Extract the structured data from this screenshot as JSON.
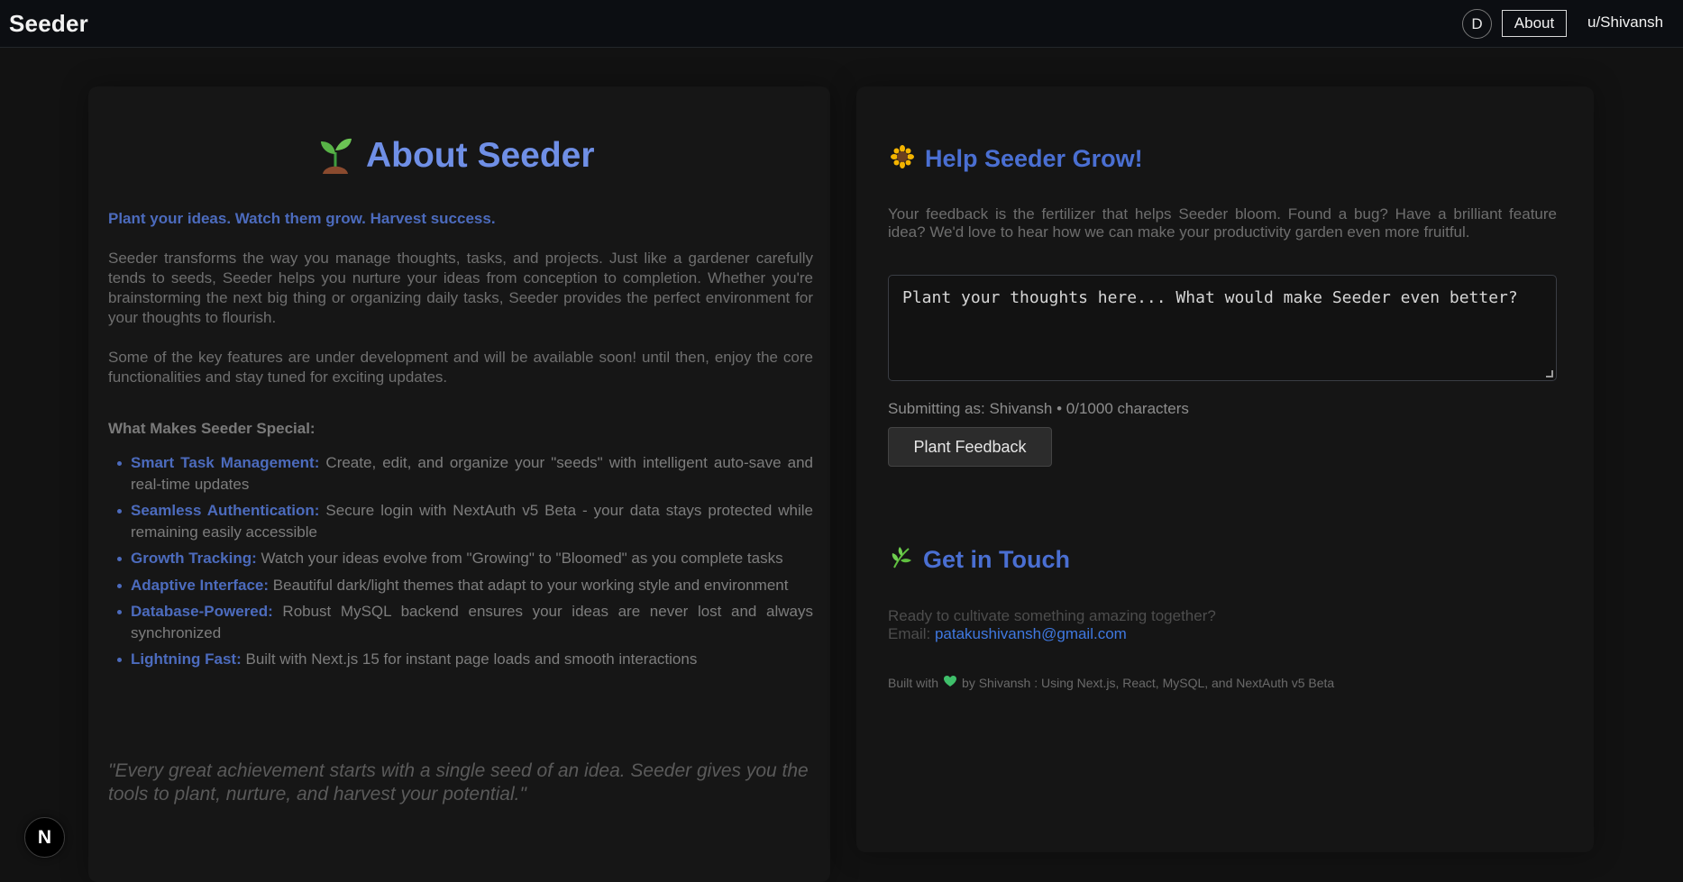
{
  "header": {
    "brand": "Seeder",
    "avatar_initial": "D",
    "about_label": "About",
    "user_label": "u/Shivansh"
  },
  "about": {
    "title": "About Seeder",
    "title_icon": "seedling-icon",
    "tagline": "Plant your ideas. Watch them grow. Harvest success.",
    "paragraph1": "Seeder transforms the way you manage thoughts, tasks, and projects. Just like a gardener carefully tends to seeds, Seeder helps you nurture your ideas from conception to completion. Whether you're brainstorming the next big thing or organizing daily tasks, Seeder provides the perfect environment for your thoughts to flourish.",
    "paragraph2": "Some of the key features are under development and will be available soon! until then, enjoy the core functionalities and stay tuned for exciting updates.",
    "features_heading": "What Makes Seeder Special:",
    "features": [
      {
        "name": "Smart Task Management:",
        "desc": " Create, edit, and organize your \"seeds\" with intelligent auto-save and real-time updates"
      },
      {
        "name": "Seamless Authentication:",
        "desc": " Secure login with NextAuth v5 Beta - your data stays protected while remaining easily accessible"
      },
      {
        "name": "Growth Tracking:",
        "desc": " Watch your ideas evolve from \"Growing\" to \"Bloomed\" as you complete tasks"
      },
      {
        "name": "Adaptive Interface:",
        "desc": " Beautiful dark/light themes that adapt to your working style and environment"
      },
      {
        "name": "Database-Powered:",
        "desc": " Robust MySQL backend ensures your ideas are never lost and always synchronized"
      },
      {
        "name": "Lightning Fast:",
        "desc": " Built with Next.js 15 for instant page loads and smooth interactions"
      }
    ],
    "quote": "\"Every great achievement starts with a single seed of an idea. Seeder gives you the tools to plant, nurture, and harvest your potential.\""
  },
  "feedback": {
    "title": "Help Seeder Grow!",
    "title_icon": "sunflower-icon",
    "description": "Your feedback is the fertilizer that helps Seeder bloom. Found a bug? Have a brilliant feature idea? We'd love to hear how we can make your productivity garden even more fruitful.",
    "placeholder": "Plant your thoughts here... What would make Seeder even better?",
    "value": "",
    "submitting_as": "Submitting as: Shivansh • 0/1000 characters",
    "button_label": "Plant Feedback"
  },
  "contact": {
    "title": "Get in Touch",
    "title_icon": "herb-icon",
    "line1": "Ready to cultivate something amazing together?",
    "email_prefix": "Email: ",
    "email": "patakushivansh@gmail.com",
    "built_prefix": "Built with",
    "built_icon": "green-heart-icon",
    "built_suffix": "by Shivansh : Using Next.js, React, MySQL, and NextAuth v5 Beta"
  },
  "dev_badge": {
    "label": "N",
    "icon": "nextjs-logo-icon"
  },
  "colors": {
    "accent": "#4a6fd2",
    "background": "#121212",
    "heart": "#3fbf6a"
  }
}
